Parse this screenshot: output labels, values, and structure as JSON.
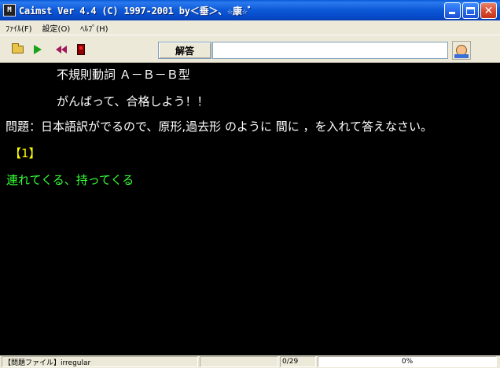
{
  "window": {
    "title": "Caimst Ver 4.4 (C) 1997-2001  by＜垂＞、☆康☆ﾞ",
    "app_icon_text": "M"
  },
  "menu": {
    "items": [
      {
        "label": "ﾌｧｲﾙ(F)"
      },
      {
        "label": "設定(O)"
      },
      {
        "label": "ﾍﾙﾌﾟ(H)"
      }
    ]
  },
  "toolbar": {
    "answer_button_label": "解答",
    "answer_input_value": "",
    "icons": [
      "folder-open-icon",
      "play-icon",
      "rewind-icon",
      "stop-icon",
      "reader-icon"
    ]
  },
  "content": {
    "heading": "不規則動詞 Ａ－Ｂ－Ｂ型",
    "encouragement": "がんばって、合格しよう！！",
    "instruction": "問題：日本語訳がでるので、原形,過去形 のように 間に ，を入れて答えなさい。",
    "question_number": "【1】",
    "question_text": "連れてくる、持ってくる",
    "colors": {
      "background": "#000000",
      "text": "#ffffff",
      "question_number": "#ffff00",
      "question_text": "#33ff33"
    }
  },
  "status": {
    "file_label": "【問題ファイル】irregular",
    "blank_panel": "",
    "count": "0/29",
    "progress_percent": 0,
    "progress_text": "0%"
  }
}
